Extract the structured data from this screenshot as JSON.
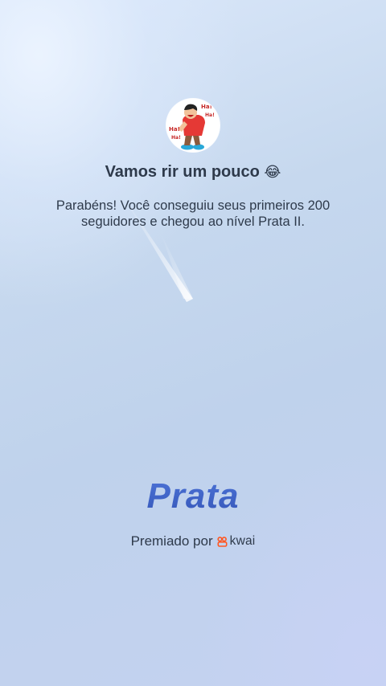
{
  "achievement": {
    "title": "Vamos rir um pouco",
    "title_emoji": "😂",
    "description": "Parabéns! Você conseguiu seus primeiros 200 seguidores e chegou ao nível Prata II.",
    "badge_icon": "laughing-man-sticker",
    "level_name": "Prata"
  },
  "footer": {
    "awarded_by_label": "Premiado por",
    "brand_name": "kwai",
    "brand_icon": "kwai-logo-icon",
    "brand_color": "#ff5722"
  },
  "colors": {
    "text": "#2e3a4b",
    "level": "#3f63c6",
    "background": "#c3d3ec"
  }
}
